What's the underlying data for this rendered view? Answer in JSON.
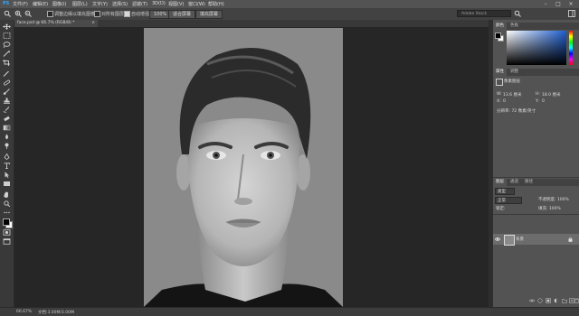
{
  "menu": {
    "items": [
      "PS",
      "文件(F)",
      "编辑(E)",
      "图像(I)",
      "图层(L)",
      "文字(Y)",
      "选择(S)",
      "滤镜(T)",
      "3D(D)",
      "视图(V)",
      "窗口(W)",
      "帮助(H)"
    ],
    "window_controls": [
      "–",
      "□",
      "×"
    ]
  },
  "options": {
    "mode_label": "调整边缘以填充图像",
    "sample_label": "对所有图层",
    "auto_label": "自动增强",
    "zoom_value": "100%",
    "btn_fit": "适合屏幕",
    "btn_fill": "填充屏幕",
    "search_placeholder": "Adobe Stock"
  },
  "document": {
    "tab_label": "face.psd @ 66.7% (RGB/8) *",
    "close": "×"
  },
  "status": {
    "zoom": "66.67%",
    "info": "文档:3.00M/3.00M"
  },
  "panels": {
    "color": {
      "tab1": "颜色",
      "tab2": "色板"
    },
    "properties": {
      "tab1": "属性",
      "tab2": "调整",
      "title": "像素图层",
      "w_label": "W:",
      "w_value": "13.6 厘米",
      "h_label": "H:",
      "h_value": "18.0 厘米",
      "x_label": "X:",
      "x_value": "0",
      "y_label": "Y:",
      "y_value": "0",
      "res_text": "分辨率: 72 像素/英寸"
    },
    "layers": {
      "tab1": "图层",
      "tab2": "通道",
      "tab3": "路径",
      "kind_label": "类型",
      "blend_mode": "正常",
      "opacity": "不透明度: 100%",
      "lock_label": "锁定:",
      "fill": "填充: 100%",
      "layer_name": "背景"
    }
  },
  "tools": [
    "move-tool",
    "marquee-tool",
    "lasso-tool",
    "quick-select-tool",
    "crop-tool",
    "eyedropper-tool",
    "healing-tool",
    "brush-tool",
    "clone-stamp-tool",
    "history-brush-tool",
    "eraser-tool",
    "gradient-tool",
    "blur-tool",
    "dodge-tool",
    "pen-tool",
    "type-tool",
    "path-select-tool",
    "shape-tool",
    "hand-tool",
    "zoom-tool",
    "more-tools"
  ],
  "colors": {
    "app_bg": "#282828",
    "panel_bg": "#535353",
    "canvas_photo_bg": "#8a8a8a"
  }
}
